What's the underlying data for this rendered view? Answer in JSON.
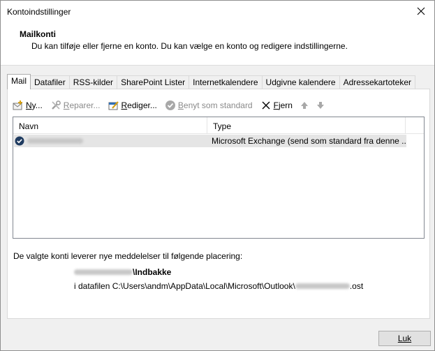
{
  "window": {
    "title": "Kontoindstillinger"
  },
  "header": {
    "title": "Mailkonti",
    "description": "Du kan tilføje eller fjerne en konto. Du kan vælge en konto og redigere indstillingerne."
  },
  "tabs": [
    {
      "label": "Mail",
      "active": true
    },
    {
      "label": "Datafiler"
    },
    {
      "label": "RSS-kilder"
    },
    {
      "label": "SharePoint Lister"
    },
    {
      "label": "Internetkalendere"
    },
    {
      "label": "Udgivne kalendere"
    },
    {
      "label": "Adressekartoteker"
    }
  ],
  "toolbar": {
    "new_pre": "N",
    "new_post": "y...",
    "repair_pre": "R",
    "repair_post": "eparer...",
    "edit_pre": "R",
    "edit_post": "ediger...",
    "default_pre": "B",
    "default_post": "enyt som standard",
    "remove_pre": "F",
    "remove_post": "jern"
  },
  "list": {
    "columns": [
      "Navn",
      "Type"
    ],
    "rows": [
      {
        "type": "Microsoft Exchange (send som standard fra denne ..."
      }
    ]
  },
  "delivery": {
    "label": "De valgte konti leverer nye meddelelser til følgende placering:",
    "inbox_suffix": "\\Indbakke",
    "datafile_prefix": "i datafilen C:\\Users\\andm\\AppData\\Local\\Microsoft\\Outlook\\",
    "datafile_suffix": ".ost"
  },
  "buttons": {
    "close": "Luk"
  },
  "colors": {
    "accent_blue": "#1e5aa8",
    "selected_row": "#e5e5e5",
    "disabled_text": "#8a8a8a"
  }
}
